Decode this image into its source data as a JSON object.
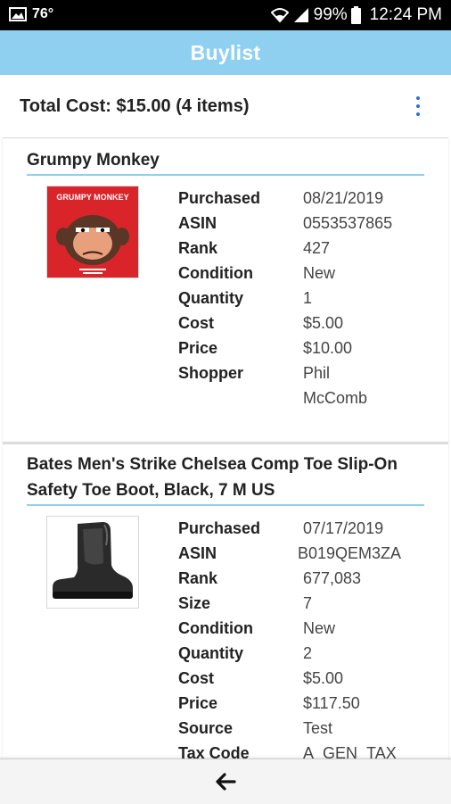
{
  "status_bar": {
    "temperature": "76°",
    "battery": "99%",
    "time": "12:24 PM",
    "icons": [
      "gallery-icon",
      "wifi-icon",
      "signal-icon",
      "battery-icon"
    ]
  },
  "app_bar": {
    "title": "Buylist"
  },
  "summary": {
    "total": "Total Cost: $15.00 (4 items)",
    "menu_icon": "more-vert-icon"
  },
  "items": [
    {
      "title": "Grumpy Monkey",
      "thumbnail": {
        "title_text": "GRUMPY MONKEY",
        "colors": {
          "background": "#d9252a",
          "monkey": "#5a3626"
        }
      },
      "fields": [
        {
          "label": "Purchased",
          "value": "08/21/2019"
        },
        {
          "label": "ASIN",
          "value": "0553537865"
        },
        {
          "label": "Rank",
          "value": "427"
        },
        {
          "label": "Condition",
          "value": "New"
        },
        {
          "label": "Quantity",
          "value": "1"
        },
        {
          "label": "Cost",
          "value": "$5.00"
        },
        {
          "label": "Price",
          "value": "$10.00"
        },
        {
          "label": "Shopper",
          "value": "Phil McComb"
        }
      ]
    },
    {
      "title": "Bates Men's Strike Chelsea Comp Toe Slip-On Safety Toe Boot, Black, 7 M US",
      "fields": [
        {
          "label": "Purchased",
          "value": "07/17/2019"
        },
        {
          "label": "ASIN",
          "value": "B019QEM3ZA"
        },
        {
          "label": "Rank",
          "value": "677,083"
        },
        {
          "label": "Size",
          "value": "7"
        },
        {
          "label": "Condition",
          "value": "New"
        },
        {
          "label": "Quantity",
          "value": "2"
        },
        {
          "label": "Cost",
          "value": "$5.00"
        },
        {
          "label": "Price",
          "value": "$117.50"
        },
        {
          "label": "Source",
          "value": "Test"
        },
        {
          "label": "Tax Code",
          "value": "A_GEN_TAX"
        }
      ]
    }
  ],
  "bottom_bar": {
    "back_icon": "arrow-left-icon"
  },
  "colors": {
    "accent": "#8fd0f1",
    "menu_dots": "#2b6fd1",
    "status_bar": "#000000"
  }
}
